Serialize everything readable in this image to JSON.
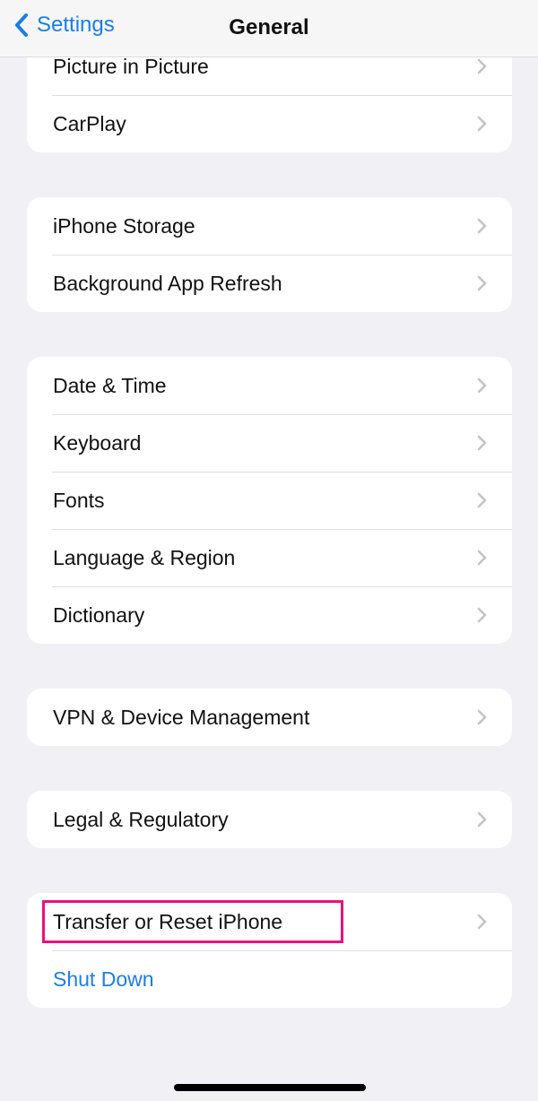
{
  "navbar": {
    "back_label": "Settings",
    "title": "General"
  },
  "groups": [
    {
      "items": [
        {
          "label": "Picture in Picture"
        },
        {
          "label": "CarPlay"
        }
      ]
    },
    {
      "items": [
        {
          "label": "iPhone Storage"
        },
        {
          "label": "Background App Refresh"
        }
      ]
    },
    {
      "items": [
        {
          "label": "Date & Time"
        },
        {
          "label": "Keyboard"
        },
        {
          "label": "Fonts"
        },
        {
          "label": "Language & Region"
        },
        {
          "label": "Dictionary"
        }
      ]
    },
    {
      "items": [
        {
          "label": "VPN & Device Management"
        }
      ]
    },
    {
      "items": [
        {
          "label": "Legal & Regulatory"
        }
      ]
    },
    {
      "items": [
        {
          "label": "Transfer or Reset iPhone",
          "highlighted": true
        },
        {
          "label": "Shut Down",
          "style": "action"
        }
      ]
    }
  ],
  "colors": {
    "accent": "#1a7fe6",
    "highlight": "#e8127b",
    "background": "#f1f1f5"
  },
  "icons": {
    "back": "chevron-left-icon",
    "disclosure": "chevron-right-icon"
  }
}
